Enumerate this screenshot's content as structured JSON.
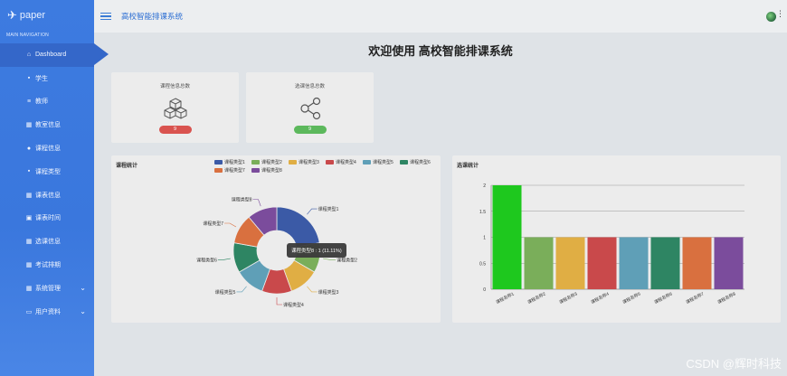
{
  "brand": {
    "name": "paper",
    "logo_icon": "paper-plane-icon"
  },
  "sidebar": {
    "header": "MAIN NAVIGATION",
    "items": [
      {
        "label": "Dashboard",
        "icon": "home-icon",
        "glyph": "⌂"
      },
      {
        "label": "学生",
        "icon": "monitor-icon",
        "glyph": "▪"
      },
      {
        "label": "教师",
        "icon": "list-icon",
        "glyph": "≡"
      },
      {
        "label": "教室信息",
        "icon": "grid-icon",
        "glyph": "▦"
      },
      {
        "label": "课程信息",
        "icon": "location-icon",
        "glyph": "●"
      },
      {
        "label": "课程类型",
        "icon": "monitor-icon",
        "glyph": "▪"
      },
      {
        "label": "课表信息",
        "icon": "grid-icon",
        "glyph": "▦"
      },
      {
        "label": "课表时间",
        "icon": "lock-icon",
        "glyph": "▣"
      },
      {
        "label": "选课信息",
        "icon": "grid-icon",
        "glyph": "▦"
      },
      {
        "label": "考试排期",
        "icon": "grid-icon",
        "glyph": "▦"
      },
      {
        "label": "系统管理",
        "icon": "grid-icon",
        "glyph": "▦",
        "chevron": "⌄"
      },
      {
        "label": "用户资料",
        "icon": "card-icon",
        "glyph": "▭",
        "chevron": "⌄"
      }
    ]
  },
  "topbar": {
    "title": "高校智能排课系统",
    "more": "⋮"
  },
  "page": {
    "welcome": "欢迎使用 高校智能排课系统"
  },
  "stats": [
    {
      "label": "课程信息总数",
      "value": "9",
      "color": "#d9534f",
      "icon": "cubes-icon"
    },
    {
      "label": "选课信息总数",
      "value": "9",
      "color": "#5cb85c",
      "icon": "share-icon"
    }
  ],
  "colors": {
    "sidebar": "#3d7be0",
    "active": "#3467c9",
    "accent": "#2d6fd3"
  },
  "chart_data": [
    {
      "type": "pie",
      "title": "课程统计",
      "categories": [
        "课程类型1",
        "课程类型2",
        "课程类型3",
        "课程类型4",
        "课程类型5",
        "课程类型6",
        "课程类型7",
        "课程类型8"
      ],
      "values": [
        2,
        1,
        1,
        1,
        1,
        1,
        1,
        1
      ],
      "colors": [
        "#3b5aa6",
        "#7aae5a",
        "#e0ae44",
        "#c9494b",
        "#5f9fb7",
        "#2e8563",
        "#d9703f",
        "#7b4c9c"
      ],
      "legend_position": "top",
      "tooltip": "课程类型8 : 1 (11.11%)"
    },
    {
      "type": "bar",
      "title": "选课统计",
      "categories": [
        "课程名称1",
        "课程名称2",
        "课程名称3",
        "课程名称4",
        "课程名称5",
        "课程名称6",
        "课程名称7",
        "课程名称8"
      ],
      "values": [
        2,
        1,
        1,
        1,
        1,
        1,
        1,
        1
      ],
      "colors": [
        "#1ec81e",
        "#7aae5a",
        "#e0ae44",
        "#c9494b",
        "#5f9fb7",
        "#2e8563",
        "#d9703f",
        "#7b4c9c"
      ],
      "ylim": [
        0,
        2
      ],
      "yticks": [
        "0",
        "0.5",
        "1",
        "1.5",
        "2"
      ],
      "grid": true
    }
  ],
  "watermark": "CSDN @辉时科技"
}
